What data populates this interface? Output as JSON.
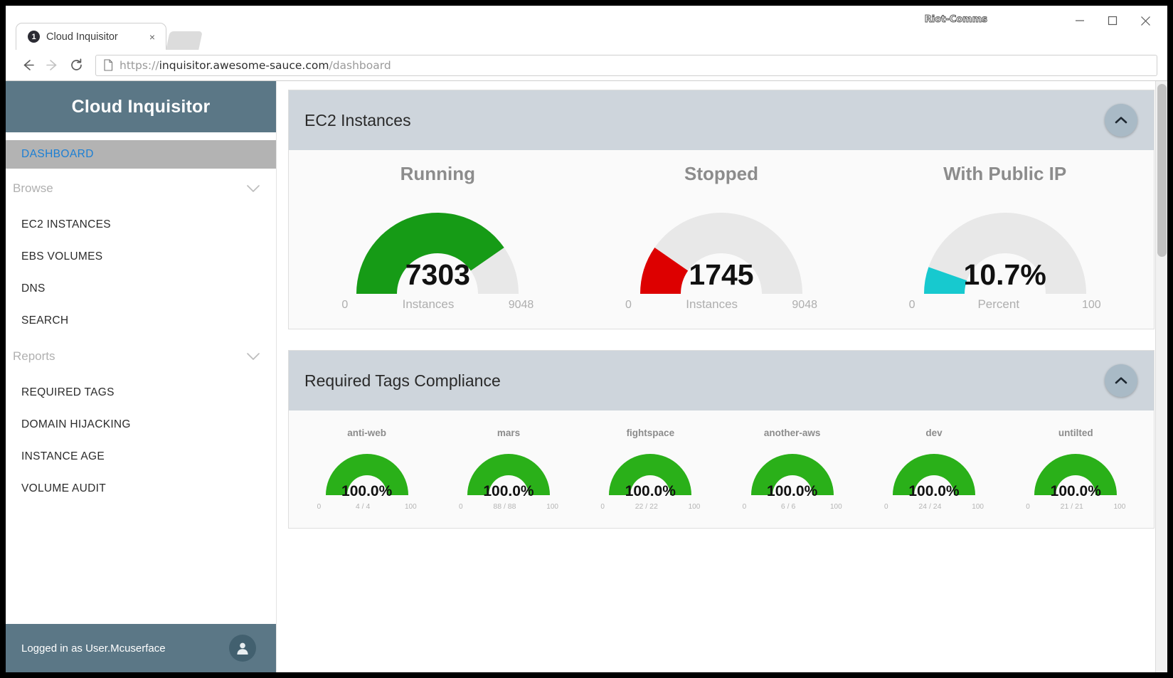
{
  "window": {
    "label": "Riot-Comms",
    "minimize_icon": "minimize-icon",
    "maximize_icon": "maximize-icon",
    "close_icon": "close-icon"
  },
  "browser": {
    "tab": {
      "favicon_badge": "1",
      "title": "Cloud Inquisitor",
      "close_label": "×"
    },
    "back_icon": "back-arrow-icon",
    "forward_icon": "forward-arrow-icon",
    "reload_icon": "reload-icon",
    "omnibox": {
      "page_icon": "page-document-icon",
      "scheme": "https://",
      "host": "inquisitor.awesome-sauce.com",
      "path": "/dashboard",
      "full_url": "https://inquisitor.awesome-sauce.com/dashboard"
    }
  },
  "sidebar": {
    "brand": "Cloud Inquisitor",
    "active_item": "DASHBOARD",
    "groups": [
      {
        "label": "Browse",
        "chevron": "chevron-down-icon",
        "items": [
          {
            "label": "EC2 INSTANCES"
          },
          {
            "label": "EBS VOLUMES"
          },
          {
            "label": "DNS"
          },
          {
            "label": "SEARCH"
          }
        ]
      },
      {
        "label": "Reports",
        "chevron": "chevron-down-icon",
        "items": [
          {
            "label": "REQUIRED TAGS"
          },
          {
            "label": "DOMAIN HIJACKING"
          },
          {
            "label": "INSTANCE AGE"
          },
          {
            "label": "VOLUME AUDIT"
          }
        ]
      }
    ],
    "footer": {
      "logged_in_text": "Logged in as User.Mcuserface",
      "avatar_icon": "user-avatar-icon"
    }
  },
  "cards": [
    {
      "title": "EC2 Instances",
      "collapse_icon": "chevron-up-icon"
    },
    {
      "title": "Required Tags Compliance",
      "collapse_icon": "chevron-up-icon"
    }
  ],
  "colors": {
    "brand": "#5b7786",
    "card_header": "#ced5dc",
    "accent_link": "#1b7fd4",
    "green": "#169b16",
    "red": "#dd0000",
    "cyan": "#17c9cf",
    "track": "#e6e6e6"
  },
  "chart_data": [
    {
      "type": "gauge",
      "title": "EC2 Instances",
      "gauges": [
        {
          "label": "Running",
          "value": 7303,
          "display": "7303",
          "min": 0,
          "max": 9048,
          "min_label": "0",
          "max_label": "9048",
          "unit": "Instances",
          "percent": 80.7,
          "color": "#169b16"
        },
        {
          "label": "Stopped",
          "value": 1745,
          "display": "1745",
          "min": 0,
          "max": 9048,
          "min_label": "0",
          "max_label": "9048",
          "unit": "Instances",
          "percent": 19.3,
          "color": "#dd0000"
        },
        {
          "label": "With Public IP",
          "value": 10.7,
          "display": "10.7%",
          "min": 0,
          "max": 100,
          "min_label": "0",
          "max_label": "100",
          "unit": "Percent",
          "percent": 10.7,
          "color": "#17c9cf"
        }
      ]
    },
    {
      "type": "gauge",
      "title": "Required Tags Compliance",
      "gauges": [
        {
          "label": "anti-web",
          "display": "100.0%",
          "min_label": "0",
          "max_label": "100",
          "unit": "4 / 4",
          "percent": 100,
          "color": "#2ab019"
        },
        {
          "label": "mars",
          "display": "100.0%",
          "min_label": "0",
          "max_label": "100",
          "unit": "88 / 88",
          "percent": 100,
          "color": "#2ab019"
        },
        {
          "label": "fightspace",
          "display": "100.0%",
          "min_label": "0",
          "max_label": "100",
          "unit": "22 / 22",
          "percent": 100,
          "color": "#2ab019"
        },
        {
          "label": "another-aws",
          "display": "100.0%",
          "min_label": "0",
          "max_label": "100",
          "unit": "6 / 6",
          "percent": 100,
          "color": "#2ab019"
        },
        {
          "label": "dev",
          "display": "100.0%",
          "min_label": "0",
          "max_label": "100",
          "unit": "24 / 24",
          "percent": 100,
          "color": "#2ab019"
        },
        {
          "label": "untilted",
          "display": "100.0%",
          "min_label": "0",
          "max_label": "100",
          "unit": "21 / 21",
          "percent": 100,
          "color": "#2ab019"
        }
      ]
    }
  ]
}
